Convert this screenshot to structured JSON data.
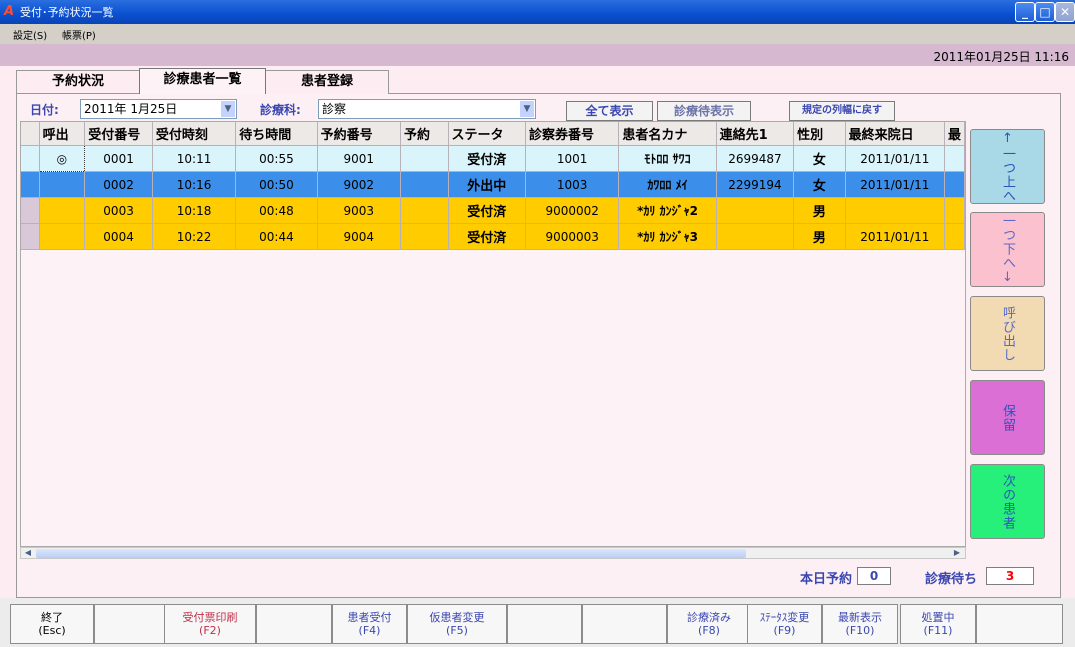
{
  "window": {
    "title": "受付･予約状況一覧",
    "icon": "app-a-icon"
  },
  "menu": [
    "設定(S)",
    "帳票(P)"
  ],
  "clock": "2011年01月25日 11:16",
  "tabs": [
    "予約状況",
    "診療患者一覧",
    "患者登録"
  ],
  "active_tab": 1,
  "filter": {
    "date_label": "日付:",
    "date_value": "2011年 1月25日",
    "dept_label": "診療科:",
    "dept_value": "診察",
    "show_all_label": "全て表示",
    "show_waiting_label": "診療待表示",
    "reset_width_label": "規定の列幅に戻す"
  },
  "table": {
    "columns": [
      "呼出",
      "受付番号",
      "受付時刻",
      "待ち時間",
      "予約番号",
      "予約",
      "ステータ",
      "診察券番号",
      "患者名カナ",
      "連絡先1",
      "性別",
      "最終来院日",
      "最"
    ],
    "rows": [
      {
        "call": "◎",
        "no": "0001",
        "time": "10:11",
        "wait": "00:55",
        "rsv_no": "9001",
        "rsv": "",
        "status": "受付済",
        "card": "1001",
        "kana": "ﾓﾄﾛﾛ ｻﾜｺ",
        "tel": "2699487",
        "sex": "女",
        "last": "2011/01/11",
        "state": "selected-light"
      },
      {
        "call": "",
        "no": "0002",
        "time": "10:16",
        "wait": "00:50",
        "rsv_no": "9002",
        "rsv": "",
        "status": "外出中",
        "card": "1003",
        "kana": "ｶﾜﾛﾛ ﾒｲ",
        "tel": "2299194",
        "sex": "女",
        "last": "2011/01/11",
        "state": "out"
      },
      {
        "call": "",
        "no": "0003",
        "time": "10:18",
        "wait": "00:48",
        "rsv_no": "9003",
        "rsv": "",
        "status": "受付済",
        "card": "9000002",
        "kana": "*ｶﾘ ｶﾝｼﾞｬ2",
        "tel": "",
        "sex": "男",
        "last": "",
        "state": "waiting"
      },
      {
        "call": "",
        "no": "0004",
        "time": "10:22",
        "wait": "00:44",
        "rsv_no": "9004",
        "rsv": "",
        "status": "受付済",
        "card": "9000003",
        "kana": "*ｶﾘ ｶﾝｼﾞｬ3",
        "tel": "",
        "sex": "男",
        "last": "2011/01/11",
        "state": "waiting"
      }
    ]
  },
  "counts": {
    "today_reservations_label": "本日予約",
    "today_reservations": "0",
    "waiting_label": "診療待ち",
    "waiting": "3"
  },
  "side_buttons": [
    {
      "label": "↑一つ上へ",
      "color": "#a9d9e6"
    },
    {
      "label": "一つ下へ↓",
      "color": "#fbc1ce"
    },
    {
      "label": "呼び出し",
      "color": "#f2dbb3"
    },
    {
      "label": "保留",
      "color": "#dc6fd6"
    },
    {
      "label": "次の患者",
      "color": "#27f07a"
    }
  ],
  "colors": {
    "row_light": "#d9f4fb",
    "row_out": "#3b8fea",
    "row_wait": "#ffcc00",
    "text_blue": "#3b47b0",
    "red": "#ff0000"
  },
  "fkeys": [
    {
      "top": "終了",
      "bottom": "(Esc)",
      "color": "#000"
    },
    {
      "top": "",
      "bottom": "",
      "color": "#000"
    },
    {
      "top": "受付票印刷",
      "bottom": "(F2)",
      "color": "#c0304a"
    },
    {
      "top": "",
      "bottom": "",
      "color": "#000"
    },
    {
      "top": "患者受付",
      "bottom": "(F4)",
      "color": "#3b47b0"
    },
    {
      "top": "仮患者変更",
      "bottom": "(F5)",
      "color": "#3b47b0"
    },
    {
      "top": "",
      "bottom": "",
      "color": "#000"
    },
    {
      "top": "",
      "bottom": "",
      "color": "#000"
    },
    {
      "top": "診療済み",
      "bottom": "(F8)",
      "color": "#3b47b0"
    },
    {
      "top": "ｽﾃｰﾀｽ変更",
      "bottom": "(F9)",
      "color": "#3b47b0"
    },
    {
      "top": "最新表示",
      "bottom": "(F10)",
      "color": "#3b47b0"
    },
    {
      "top": "処置中",
      "bottom": "(F11)",
      "color": "#3b47b0"
    },
    {
      "top": "",
      "bottom": "",
      "color": "#000"
    }
  ]
}
